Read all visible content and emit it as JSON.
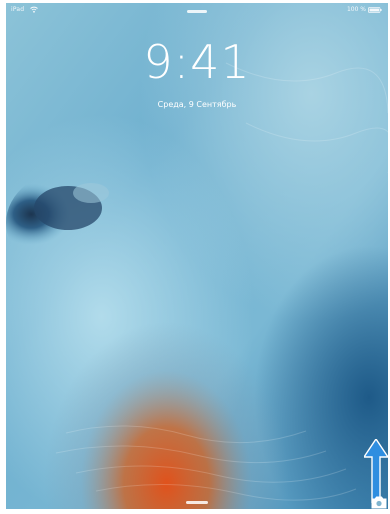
{
  "status_bar": {
    "device_name": "iPad",
    "battery_percent": "100 %",
    "wifi_icon": "wifi-icon",
    "battery_icon": "battery-icon",
    "battery_level": 1.0
  },
  "lock_screen": {
    "time": "9:41",
    "date": "Среда, 9 Сентябрь"
  },
  "icons": {
    "swipe_arrow": "arrow-up-icon",
    "camera": "camera-icon"
  },
  "colors": {
    "arrow": "#2f8ee0",
    "text": "#ffffff"
  }
}
